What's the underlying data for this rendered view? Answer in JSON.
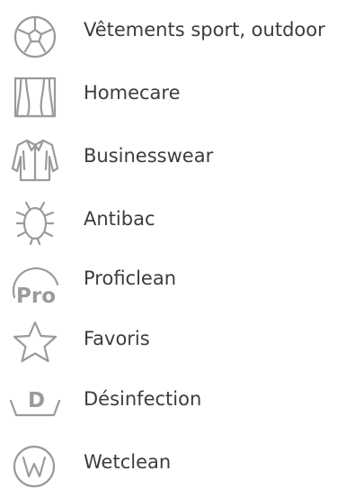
{
  "theme": {
    "text_color": "#3c3c3c",
    "icon_color": "#9a9a9a",
    "background": "#ffffff"
  },
  "programs": [
    {
      "label": "Vêtements sport, outdoor",
      "icon": "soccer-ball-icon"
    },
    {
      "label": "Homecare",
      "icon": "curtains-icon"
    },
    {
      "label": "Businesswear",
      "icon": "shirt-icon"
    },
    {
      "label": "Antibac",
      "icon": "bacteria-icon"
    },
    {
      "label": "Proficlean",
      "icon": "pro-icon",
      "icon_text": "Pro"
    },
    {
      "label": "Favoris",
      "icon": "star-icon"
    },
    {
      "label": "Désinfection",
      "icon": "disinfection-tub-icon",
      "icon_text": "D"
    },
    {
      "label": "Wetclean",
      "icon": "wetclean-circle-w-icon"
    }
  ]
}
